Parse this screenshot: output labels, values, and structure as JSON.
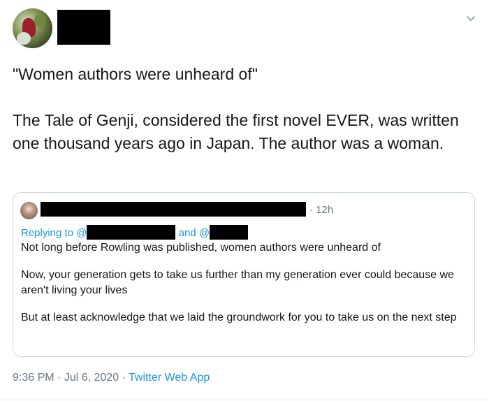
{
  "tweet": {
    "text_line1": "\"Women authors were unheard of\"",
    "text_line2": "The Tale of Genji, considered the first novel EVER, was written one thousand years ago in Japan. The author was a woman."
  },
  "quoted": {
    "time": "· 12h",
    "replying_to": "Replying to @",
    "and": "and @",
    "paragraph1": "Not long before Rowling was published, women authors were unheard of",
    "paragraph2": "Now, your generation gets to take us further than my generation ever could because we aren't living your lives",
    "paragraph3": "But at least acknowledge that we laid the groundwork for you to take us on the next step"
  },
  "meta": {
    "time": "9:36 PM",
    "sep1": " · ",
    "date": "Jul 6, 2020",
    "sep2": " · ",
    "source": "Twitter Web App"
  },
  "icons": {
    "menu": "chevron-down-icon"
  }
}
